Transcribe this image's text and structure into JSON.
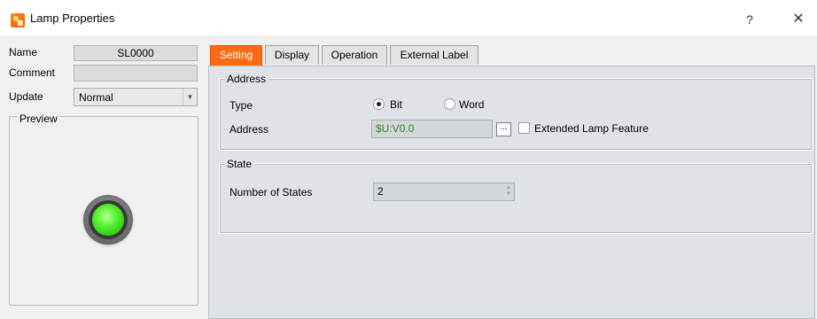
{
  "window": {
    "title": "Lamp Properties",
    "help_label": "?",
    "close_label": "✕"
  },
  "left_panel": {
    "name_label": "Name",
    "name_value": "SL0000",
    "comment_label": "Comment",
    "comment_value": "",
    "update_label": "Update",
    "update_value": "Normal",
    "preview_label": "Preview"
  },
  "tabs": [
    {
      "label": "Setting",
      "active": true
    },
    {
      "label": "Display",
      "active": false
    },
    {
      "label": "Operation",
      "active": false
    },
    {
      "label": "External Label",
      "active": false
    }
  ],
  "address_group": {
    "legend": "Address",
    "type_label": "Type",
    "type_options": [
      {
        "label": "Bit",
        "checked": true
      },
      {
        "label": "Word",
        "checked": false
      }
    ],
    "address_label": "Address",
    "address_value": "$U:V0.0",
    "browse_label": "...",
    "extended_label": "Extended Lamp Feature",
    "extended_checked": false
  },
  "state_group": {
    "legend": "State",
    "states_label": "Number of States",
    "states_value": "2"
  },
  "colors": {
    "accent_tab": "#ff6a15",
    "address_text": "#2e8b2e",
    "lamp_green": "#5ff53a"
  },
  "icons": {
    "app": "lamp-app-icon",
    "lamp": "green-lamp-icon"
  }
}
